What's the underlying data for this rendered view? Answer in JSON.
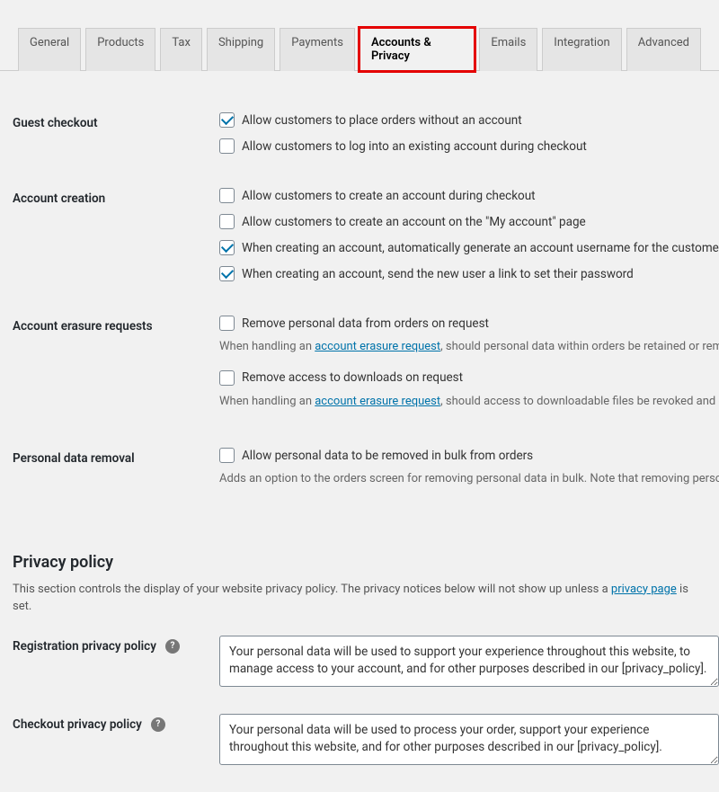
{
  "tabs": {
    "general": "General",
    "products": "Products",
    "tax": "Tax",
    "shipping": "Shipping",
    "payments": "Payments",
    "accounts_privacy": "Accounts & Privacy",
    "emails": "Emails",
    "integration": "Integration",
    "advanced": "Advanced"
  },
  "guest_checkout": {
    "heading": "Guest checkout",
    "opt1": "Allow customers to place orders without an account",
    "opt2": "Allow customers to log into an existing account during checkout"
  },
  "account_creation": {
    "heading": "Account creation",
    "opt1": "Allow customers to create an account during checkout",
    "opt2": "Allow customers to create an account on the \"My account\" page",
    "opt3": "When creating an account, automatically generate an account username for the customer based on their name, surname or email",
    "opt4": "When creating an account, send the new user a link to set their password"
  },
  "erasure": {
    "heading": "Account erasure requests",
    "opt1": "Remove personal data from orders on request",
    "desc1_pre": "When handling an ",
    "desc1_link": "account erasure request",
    "desc1_post": ", should personal data within orders be retained or removed?",
    "opt2": "Remove access to downloads on request",
    "desc2_pre": "When handling an ",
    "desc2_link": "account erasure request",
    "desc2_post": ", should access to downloadable files be revoked and download logs cleared?"
  },
  "removal": {
    "heading": "Personal data removal",
    "opt1": "Allow personal data to be removed in bulk from orders",
    "desc1": "Adds an option to the orders screen for removing personal data in bulk. Note that removing personal data cannot be undone."
  },
  "privacy": {
    "title": "Privacy policy",
    "intro_pre": "This section controls the display of your website privacy policy. The privacy notices below will not show up unless a ",
    "intro_link": "privacy page",
    "intro_post": " is set.",
    "reg_label": "Registration privacy policy",
    "reg_value": "Your personal data will be used to support your experience throughout this website, to manage access to your account, and for other purposes described in our [privacy_policy].",
    "checkout_label": "Checkout privacy policy",
    "checkout_value": "Your personal data will be used to process your order, support your experience throughout this website, and for other purposes described in our [privacy_policy]."
  }
}
